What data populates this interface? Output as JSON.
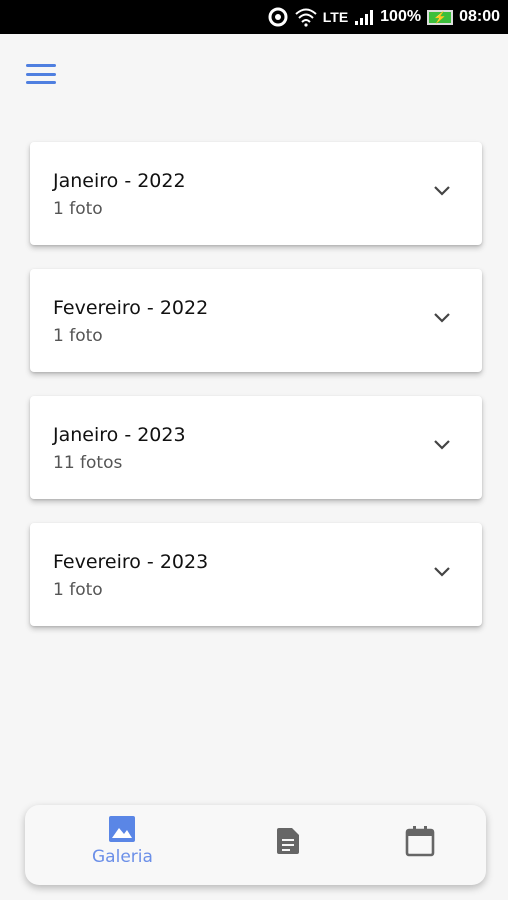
{
  "status_bar": {
    "network": "LTE",
    "battery": "100%",
    "time": "08:00"
  },
  "months": [
    {
      "title": "Janeiro - 2022",
      "count": "1 foto"
    },
    {
      "title": "Fevereiro - 2022",
      "count": "1 foto"
    },
    {
      "title": "Janeiro - 2023",
      "count": "11 fotos"
    },
    {
      "title": "Fevereiro - 2023",
      "count": "1 foto"
    }
  ],
  "bottom_nav": {
    "items": [
      {
        "icon": "image-icon",
        "label": "Galeria",
        "active": true
      },
      {
        "icon": "document-icon",
        "label": "",
        "active": false
      },
      {
        "icon": "calendar-icon",
        "label": "",
        "active": false
      }
    ]
  },
  "colors": {
    "accent": "#4f7fe0",
    "inactive_icon": "#666666"
  }
}
